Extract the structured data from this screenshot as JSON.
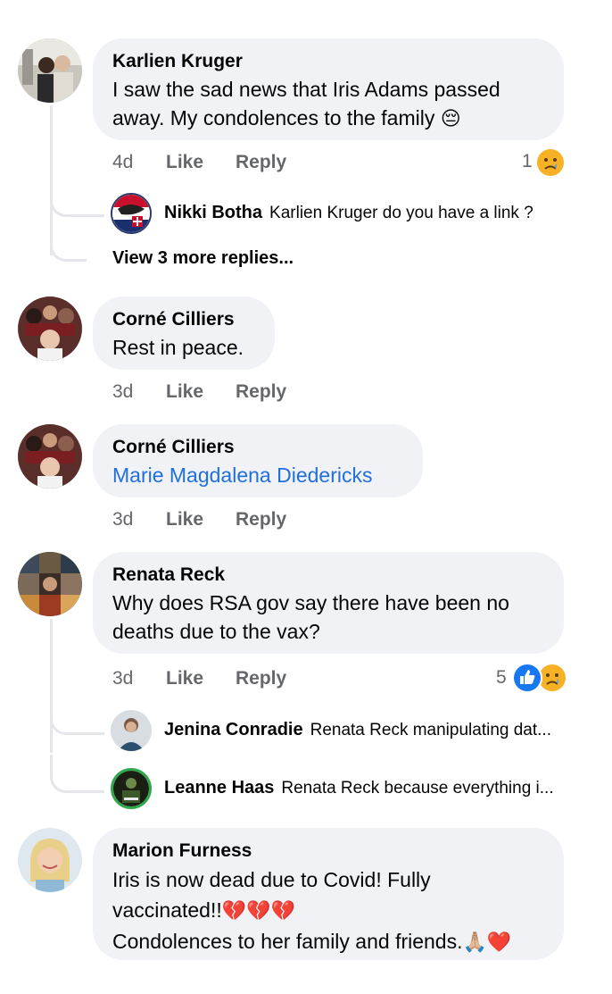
{
  "comments": [
    {
      "author": "Karlien Kruger",
      "text_line1": "I saw the sad news that Iris Adams passed",
      "text_line2": "away.  My condolences to the family",
      "emoji": "😔",
      "time": "4d",
      "like": "Like",
      "reply": "Reply",
      "reaction_count": "1",
      "replies": [
        {
          "author": "Nikki Botha",
          "text": "Karlien Kruger do you have a link ?"
        }
      ],
      "view_more": "View 3 more replies..."
    },
    {
      "author": "Corné Cilliers",
      "text": "Rest in peace.",
      "time": "3d",
      "like": "Like",
      "reply": "Reply"
    },
    {
      "author": "Corné Cilliers",
      "mention": "Marie Magdalena Diedericks",
      "time": "3d",
      "like": "Like",
      "reply": "Reply"
    },
    {
      "author": "Renata Reck",
      "text_line1": "Why does RSA gov say there have been no",
      "text_line2": "deaths due to the vax?",
      "time": "3d",
      "like": "Like",
      "reply": "Reply",
      "reaction_count": "5",
      "replies": [
        {
          "author": "Jenina Conradie",
          "text": "Renata Reck manipulating dat..."
        },
        {
          "author": "Leanne Haas",
          "text": "Renata Reck because everything i..."
        }
      ]
    },
    {
      "author": "Marion Furness",
      "text_line1": "Iris is now dead due to Covid!  Fully",
      "text_line2": "vaccinated!!",
      "emoji2": "💔💔💔",
      "text_line3": "Condolences to her family and friends.",
      "emoji3": "🙏🏼❤️"
    }
  ],
  "icons": {
    "sad_reaction": "sad-face-icon",
    "like_reaction": "thumbs-up-icon"
  },
  "colors": {
    "bubble": "#f0f2f5",
    "mention": "#216fdb",
    "secondary_text": "#65676b",
    "like_blue": "#1877f2",
    "sad_yellow": "#f7b125"
  }
}
